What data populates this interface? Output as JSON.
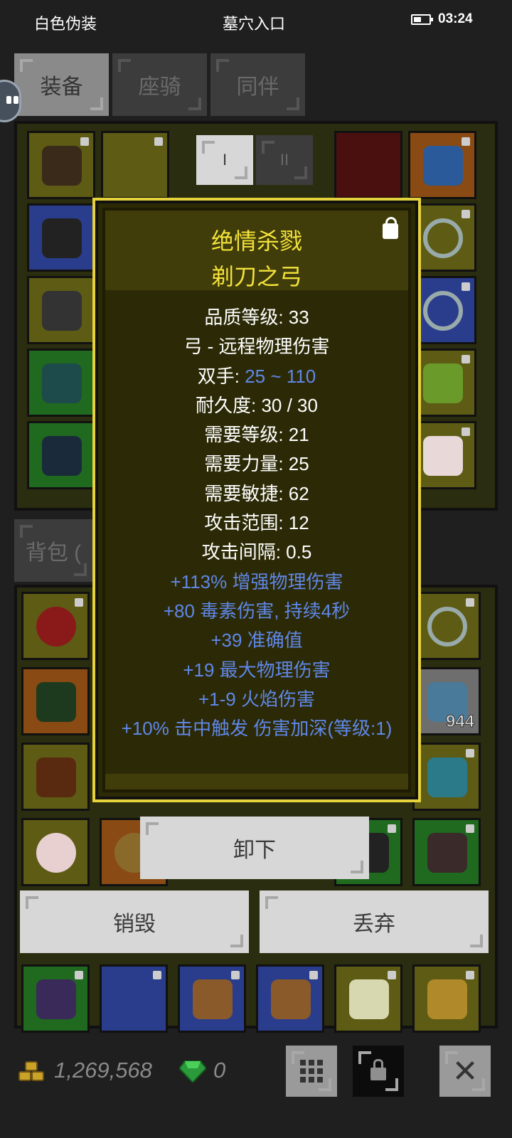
{
  "status_bar": {
    "left_text": "白色伪装",
    "center_text": "墓穴入口",
    "time": "03:24"
  },
  "tabs": [
    {
      "label": "装备",
      "active": true
    },
    {
      "label": "座骑",
      "active": false
    },
    {
      "label": "同伴",
      "active": false
    }
  ],
  "equip_panel": {
    "set_buttons": [
      "I",
      "II"
    ]
  },
  "bag_tab": {
    "label": "背包 ("
  },
  "tooltip": {
    "title_line1": "绝情杀戮",
    "title_line2": "剃刀之弓",
    "title_color": "#f4e23a",
    "stats": [
      {
        "text": "品质等级: 33"
      },
      {
        "text": "弓 - 远程物理伤害"
      },
      {
        "label": "双手: ",
        "value": "25 ~ 110"
      },
      {
        "text": "耐久度: 30 / 30"
      },
      {
        "text": "需要等级: 21"
      },
      {
        "text": "需要力量: 25"
      },
      {
        "text": "需要敏捷: 62"
      },
      {
        "text": "攻击范围: 12"
      },
      {
        "text": "攻击间隔: 0.5"
      }
    ],
    "affixes": [
      "+113% 增强物理伤害",
      "+80 毒素伤害, 持续4秒",
      "+39 准确值",
      "+19 最大物理伤害",
      "+1-9 火焰伤害",
      "+10% 击中触发 伤害加深(等级:1)"
    ],
    "affix_color": "#5f87e8"
  },
  "bag_item_count": "944",
  "actions": {
    "unequip": "卸下",
    "destroy": "销毁",
    "discard": "丢弃"
  },
  "bottom_bar": {
    "gold": "1,269,568",
    "gems": "0",
    "icons": [
      "grid-icon",
      "lock-icon",
      "close-icon"
    ]
  }
}
